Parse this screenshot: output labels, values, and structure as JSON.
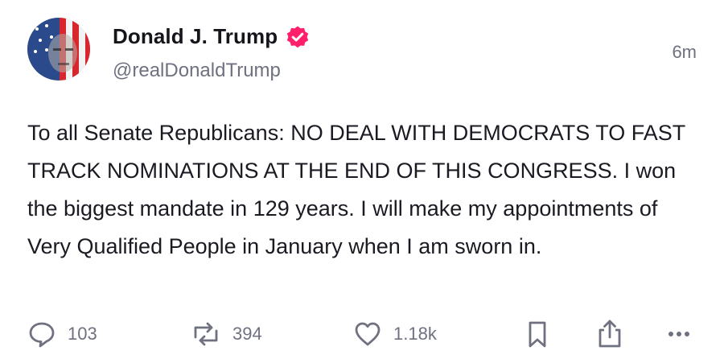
{
  "post": {
    "author": {
      "display_name": "Donald J. Trump",
      "handle": "@realDonaldTrump",
      "verified_icon": "verified-badge-icon",
      "verified_color": "#ff1f6b"
    },
    "time_ago": "6m",
    "text": "To all Senate Republicans: NO DEAL WITH DEMOCRATS TO FAST TRACK NOMINATIONS AT THE END OF THIS CONGRESS. I won the biggest mandate in 129 years. I will make my appointments of Very Qualified People in January when I am sworn in."
  },
  "actions": {
    "reply": {
      "icon": "comment-icon",
      "count": "103"
    },
    "repost": {
      "icon": "repost-icon",
      "count": "394"
    },
    "like": {
      "icon": "heart-icon",
      "count": "1.18k"
    },
    "bookmark": {
      "icon": "bookmark-icon"
    },
    "share": {
      "icon": "share-icon"
    },
    "more": {
      "icon": "more-icon"
    }
  },
  "colors": {
    "text_primary": "#15161c",
    "text_secondary": "#6f7180",
    "background": "#ffffff"
  }
}
